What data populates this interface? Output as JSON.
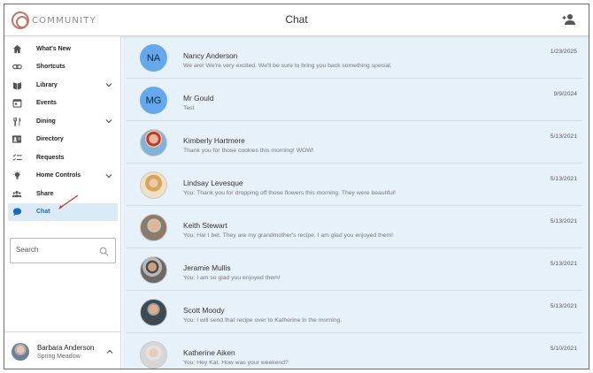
{
  "app": {
    "logo_text": "COMMUNITY",
    "title": "Chat"
  },
  "sidebar": {
    "items": [
      {
        "label": "What's New",
        "icon": "home-icon"
      },
      {
        "label": "Shortcuts",
        "icon": "link-icon"
      },
      {
        "label": "Library",
        "icon": "book-icon",
        "expandable": true
      },
      {
        "label": "Events",
        "icon": "calendar-icon"
      },
      {
        "label": "Dining",
        "icon": "fork-knife-icon",
        "expandable": true
      },
      {
        "label": "Directory",
        "icon": "contact-card-icon"
      },
      {
        "label": "Requests",
        "icon": "checklist-icon"
      },
      {
        "label": "Home Controls",
        "icon": "lightbulb-icon",
        "expandable": true
      },
      {
        "label": "Share",
        "icon": "people-icon"
      },
      {
        "label": "Chat",
        "icon": "chat-bubble-icon",
        "active": true
      }
    ],
    "search": {
      "placeholder": "Search"
    },
    "user": {
      "name": "Barbara Anderson",
      "location": "Spring Meadow"
    }
  },
  "chats": [
    {
      "name": "Nancy Anderson",
      "message": "We are! We're very excited. We'll be sure to bring you back something special.",
      "date": "1/23/2025",
      "initials": "NA"
    },
    {
      "name": "Mr Gould",
      "message": "Test",
      "date": "9/9/2024",
      "initials": "MG"
    },
    {
      "name": "Kimberly Hartmere",
      "message": "Thank you for those cookies this morning! WOW!",
      "date": "5/13/2021"
    },
    {
      "name": "Lindsay Levesque",
      "message": "You: Thank you for dropping off those flowers this morning. They were beautiful!",
      "date": "5/13/2021"
    },
    {
      "name": "Keith Stewart",
      "message": "You: Ha! I bet. They are my grandmother's recipe. I am glad you enjoyed them!",
      "date": "5/13/2021"
    },
    {
      "name": "Jeramie Mullis",
      "message": "You: I am so glad you enjoyed them!",
      "date": "5/13/2021"
    },
    {
      "name": "Scott Moody",
      "message": "You: I will send that recipe over to Katherine in the morning.",
      "date": "5/13/2021"
    },
    {
      "name": "Katherine Aiken",
      "message": "You: Hey Kat. How was your weekend?",
      "date": "5/10/2021"
    }
  ],
  "colors": {
    "accent": "#1769c2",
    "avatar_bg": "#64a9ee",
    "list_bg": "#e7f1fa",
    "annotation_arrow": "#c0392b"
  }
}
